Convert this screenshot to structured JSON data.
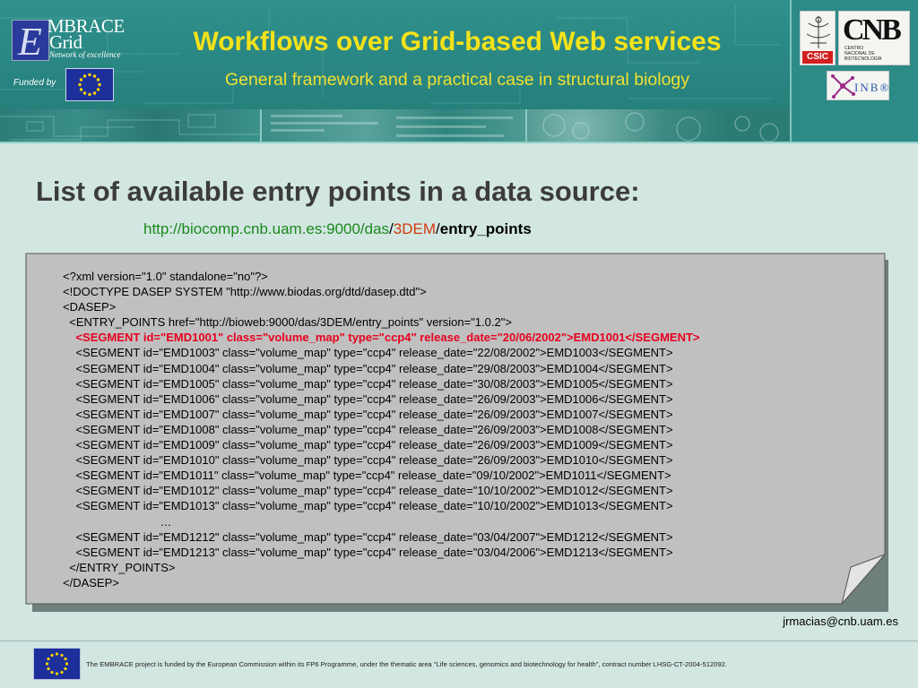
{
  "header": {
    "title": "Workflows over Grid-based Web services",
    "subtitle": "General framework and a practical case in structural biology",
    "embrace_logo": {
      "letter": "E",
      "word": "MBRACE\nGrid",
      "tagline": "Network of excellence"
    },
    "funded_by": "Funded by",
    "csic_logo": "CSIC",
    "cnb_logo": {
      "name": "CNB",
      "subtitle": "CENTRO\nNACIONAL DE\nBIOTECNOLOGÍA"
    },
    "inb_logo": "INB®",
    "colors": {
      "title": "#f4e21a",
      "background": "#2d8b87"
    }
  },
  "main": {
    "heading": "List of available entry points in a data source:",
    "url": {
      "base": "http://biocomp.cnb.uam.es:9000/das",
      "slash1": "/",
      "segment": "3DEM",
      "slash2": "/",
      "last": "entry_points"
    },
    "xml_lines": [
      {
        "text": "<?xml version=\"1.0\" standalone=\"no\"?>",
        "highlight": false
      },
      {
        "text": "<!DOCTYPE DASEP SYSTEM \"http://www.biodas.org/dtd/dasep.dtd\">",
        "highlight": false
      },
      {
        "text": "<DASEP>",
        "highlight": false
      },
      {
        "text": "  <ENTRY_POINTS href=\"http://bioweb:9000/das/3DEM/entry_points\" version=\"1.0.2\">",
        "highlight": false
      },
      {
        "text": "    <SEGMENT id=\"EMD1001\" class=\"volume_map\" type=\"ccp4\" release_date=\"20/06/2002\">EMD1001</SEGMENT>",
        "highlight": true
      },
      {
        "text": "    <SEGMENT id=\"EMD1003\" class=\"volume_map\" type=\"ccp4\" release_date=\"22/08/2002\">EMD1003</SEGMENT>",
        "highlight": false
      },
      {
        "text": "    <SEGMENT id=\"EMD1004\" class=\"volume_map\" type=\"ccp4\" release_date=\"29/08/2003\">EMD1004</SEGMENT>",
        "highlight": false
      },
      {
        "text": "    <SEGMENT id=\"EMD1005\" class=\"volume_map\" type=\"ccp4\" release_date=\"30/08/2003\">EMD1005</SEGMENT>",
        "highlight": false
      },
      {
        "text": "    <SEGMENT id=\"EMD1006\" class=\"volume_map\" type=\"ccp4\" release_date=\"26/09/2003\">EMD1006</SEGMENT>",
        "highlight": false
      },
      {
        "text": "    <SEGMENT id=\"EMD1007\" class=\"volume_map\" type=\"ccp4\" release_date=\"26/09/2003\">EMD1007</SEGMENT>",
        "highlight": false
      },
      {
        "text": "    <SEGMENT id=\"EMD1008\" class=\"volume_map\" type=\"ccp4\" release_date=\"26/09/2003\">EMD1008</SEGMENT>",
        "highlight": false
      },
      {
        "text": "    <SEGMENT id=\"EMD1009\" class=\"volume_map\" type=\"ccp4\" release_date=\"26/09/2003\">EMD1009</SEGMENT>",
        "highlight": false
      },
      {
        "text": "    <SEGMENT id=\"EMD1010\" class=\"volume_map\" type=\"ccp4\" release_date=\"26/09/2003\">EMD1010</SEGMENT>",
        "highlight": false
      },
      {
        "text": "    <SEGMENT id=\"EMD1011\" class=\"volume_map\" type=\"ccp4\" release_date=\"09/10/2002\">EMD1011</SEGMENT>",
        "highlight": false
      },
      {
        "text": "    <SEGMENT id=\"EMD1012\" class=\"volume_map\" type=\"ccp4\" release_date=\"10/10/2002\">EMD1012</SEGMENT>",
        "highlight": false
      },
      {
        "text": "    <SEGMENT id=\"EMD1013\" class=\"volume_map\" type=\"ccp4\" release_date=\"10/10/2002\">EMD1013</SEGMENT>",
        "highlight": false
      },
      {
        "text": "                              …",
        "highlight": false
      },
      {
        "text": "    <SEGMENT id=\"EMD1212\" class=\"volume_map\" type=\"ccp4\" release_date=\"03/04/2007\">EMD1212</SEGMENT>",
        "highlight": false
      },
      {
        "text": "    <SEGMENT id=\"EMD1213\" class=\"volume_map\" type=\"ccp4\" release_date=\"03/04/2006\">EMD1213</SEGMENT>",
        "highlight": false
      },
      {
        "text": "  </ENTRY_POINTS>",
        "highlight": false
      },
      {
        "text": "</DASEP>",
        "highlight": false
      }
    ],
    "email": "jrmacias@cnb.uam.es",
    "colors": {
      "highlight": "#e8001e",
      "url_base": "#1a8a1a",
      "url_segment": "#d13a0e",
      "paper": "#c0c0c0"
    }
  },
  "footer": {
    "text": "The EMBRACE project is funded by the European Commission within its FP6 Programme, under the thematic area \"Life sciences, genomics and biotechnology for health\", contract number LHSG-CT-2004-512092."
  }
}
